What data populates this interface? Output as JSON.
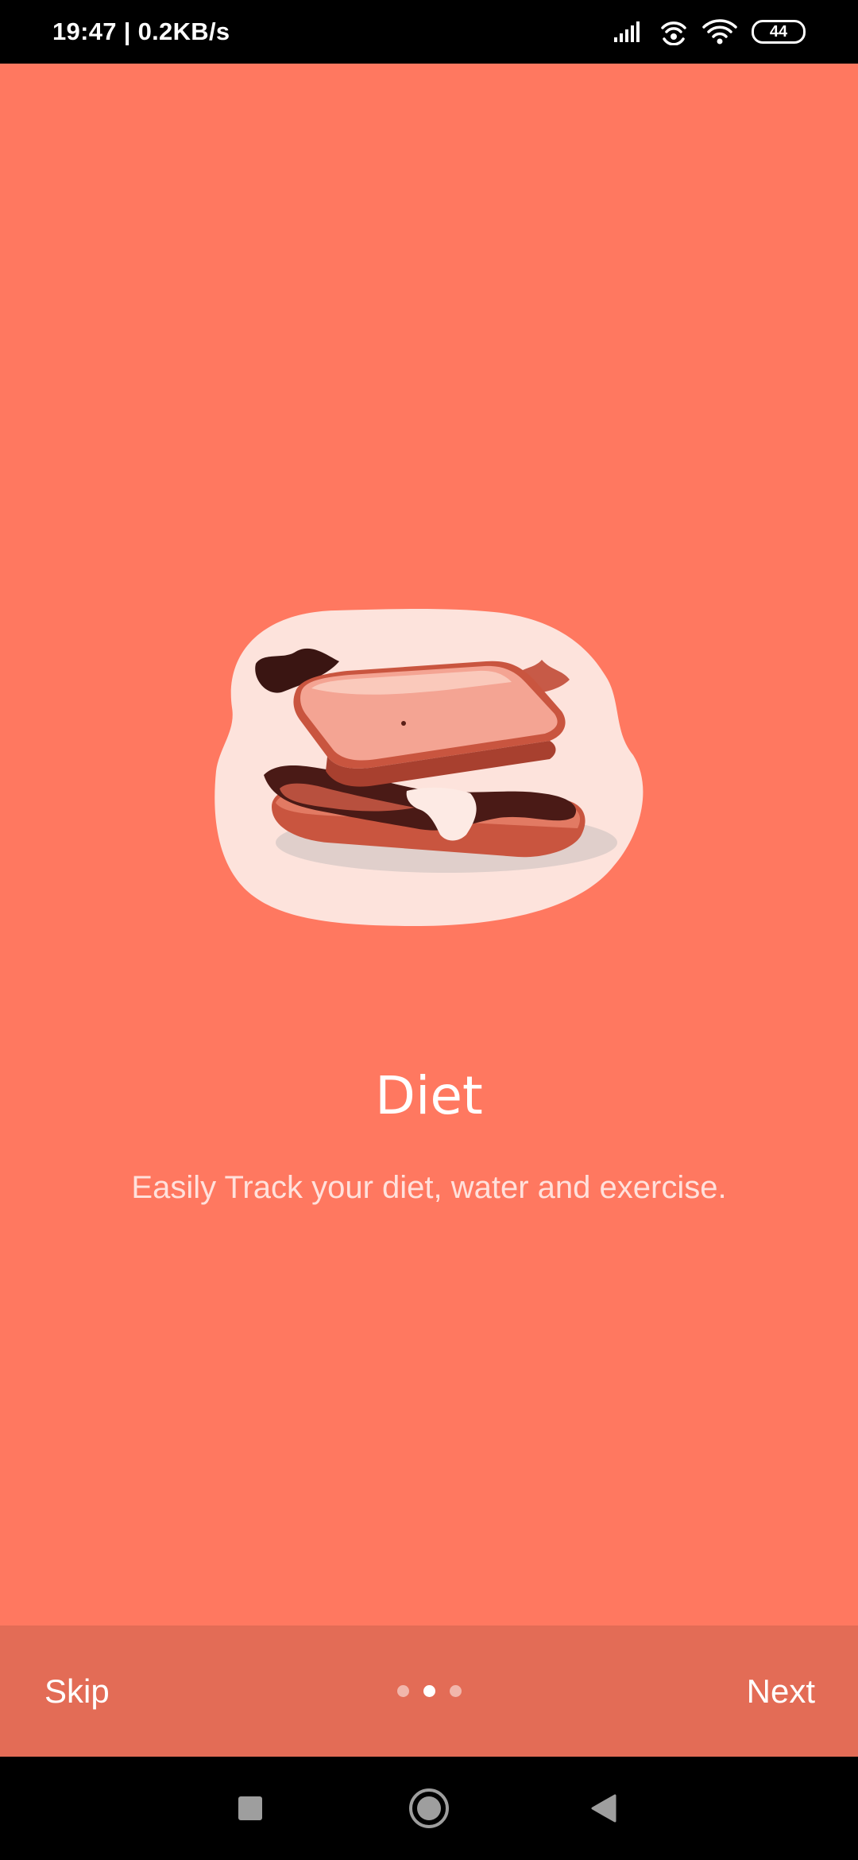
{
  "status_bar": {
    "time_and_speed": "19:47 | 0.2KB/s",
    "battery_level": "44",
    "icons": [
      "signal-icon",
      "hotspot-icon",
      "wifi-icon",
      "battery-icon"
    ]
  },
  "onboarding": {
    "illustration": "sandwich-illustration",
    "title": "Diet",
    "description": "Easily Track your diet, water and exercise.",
    "background_color": "#FF7860"
  },
  "bottom_bar": {
    "skip_label": "Skip",
    "next_label": "Next",
    "pages": 3,
    "active_page": 2,
    "background_color": "#E36C56"
  },
  "nav_bar": {
    "buttons": [
      "recents-square-icon",
      "home-circle-icon",
      "back-triangle-icon"
    ]
  }
}
